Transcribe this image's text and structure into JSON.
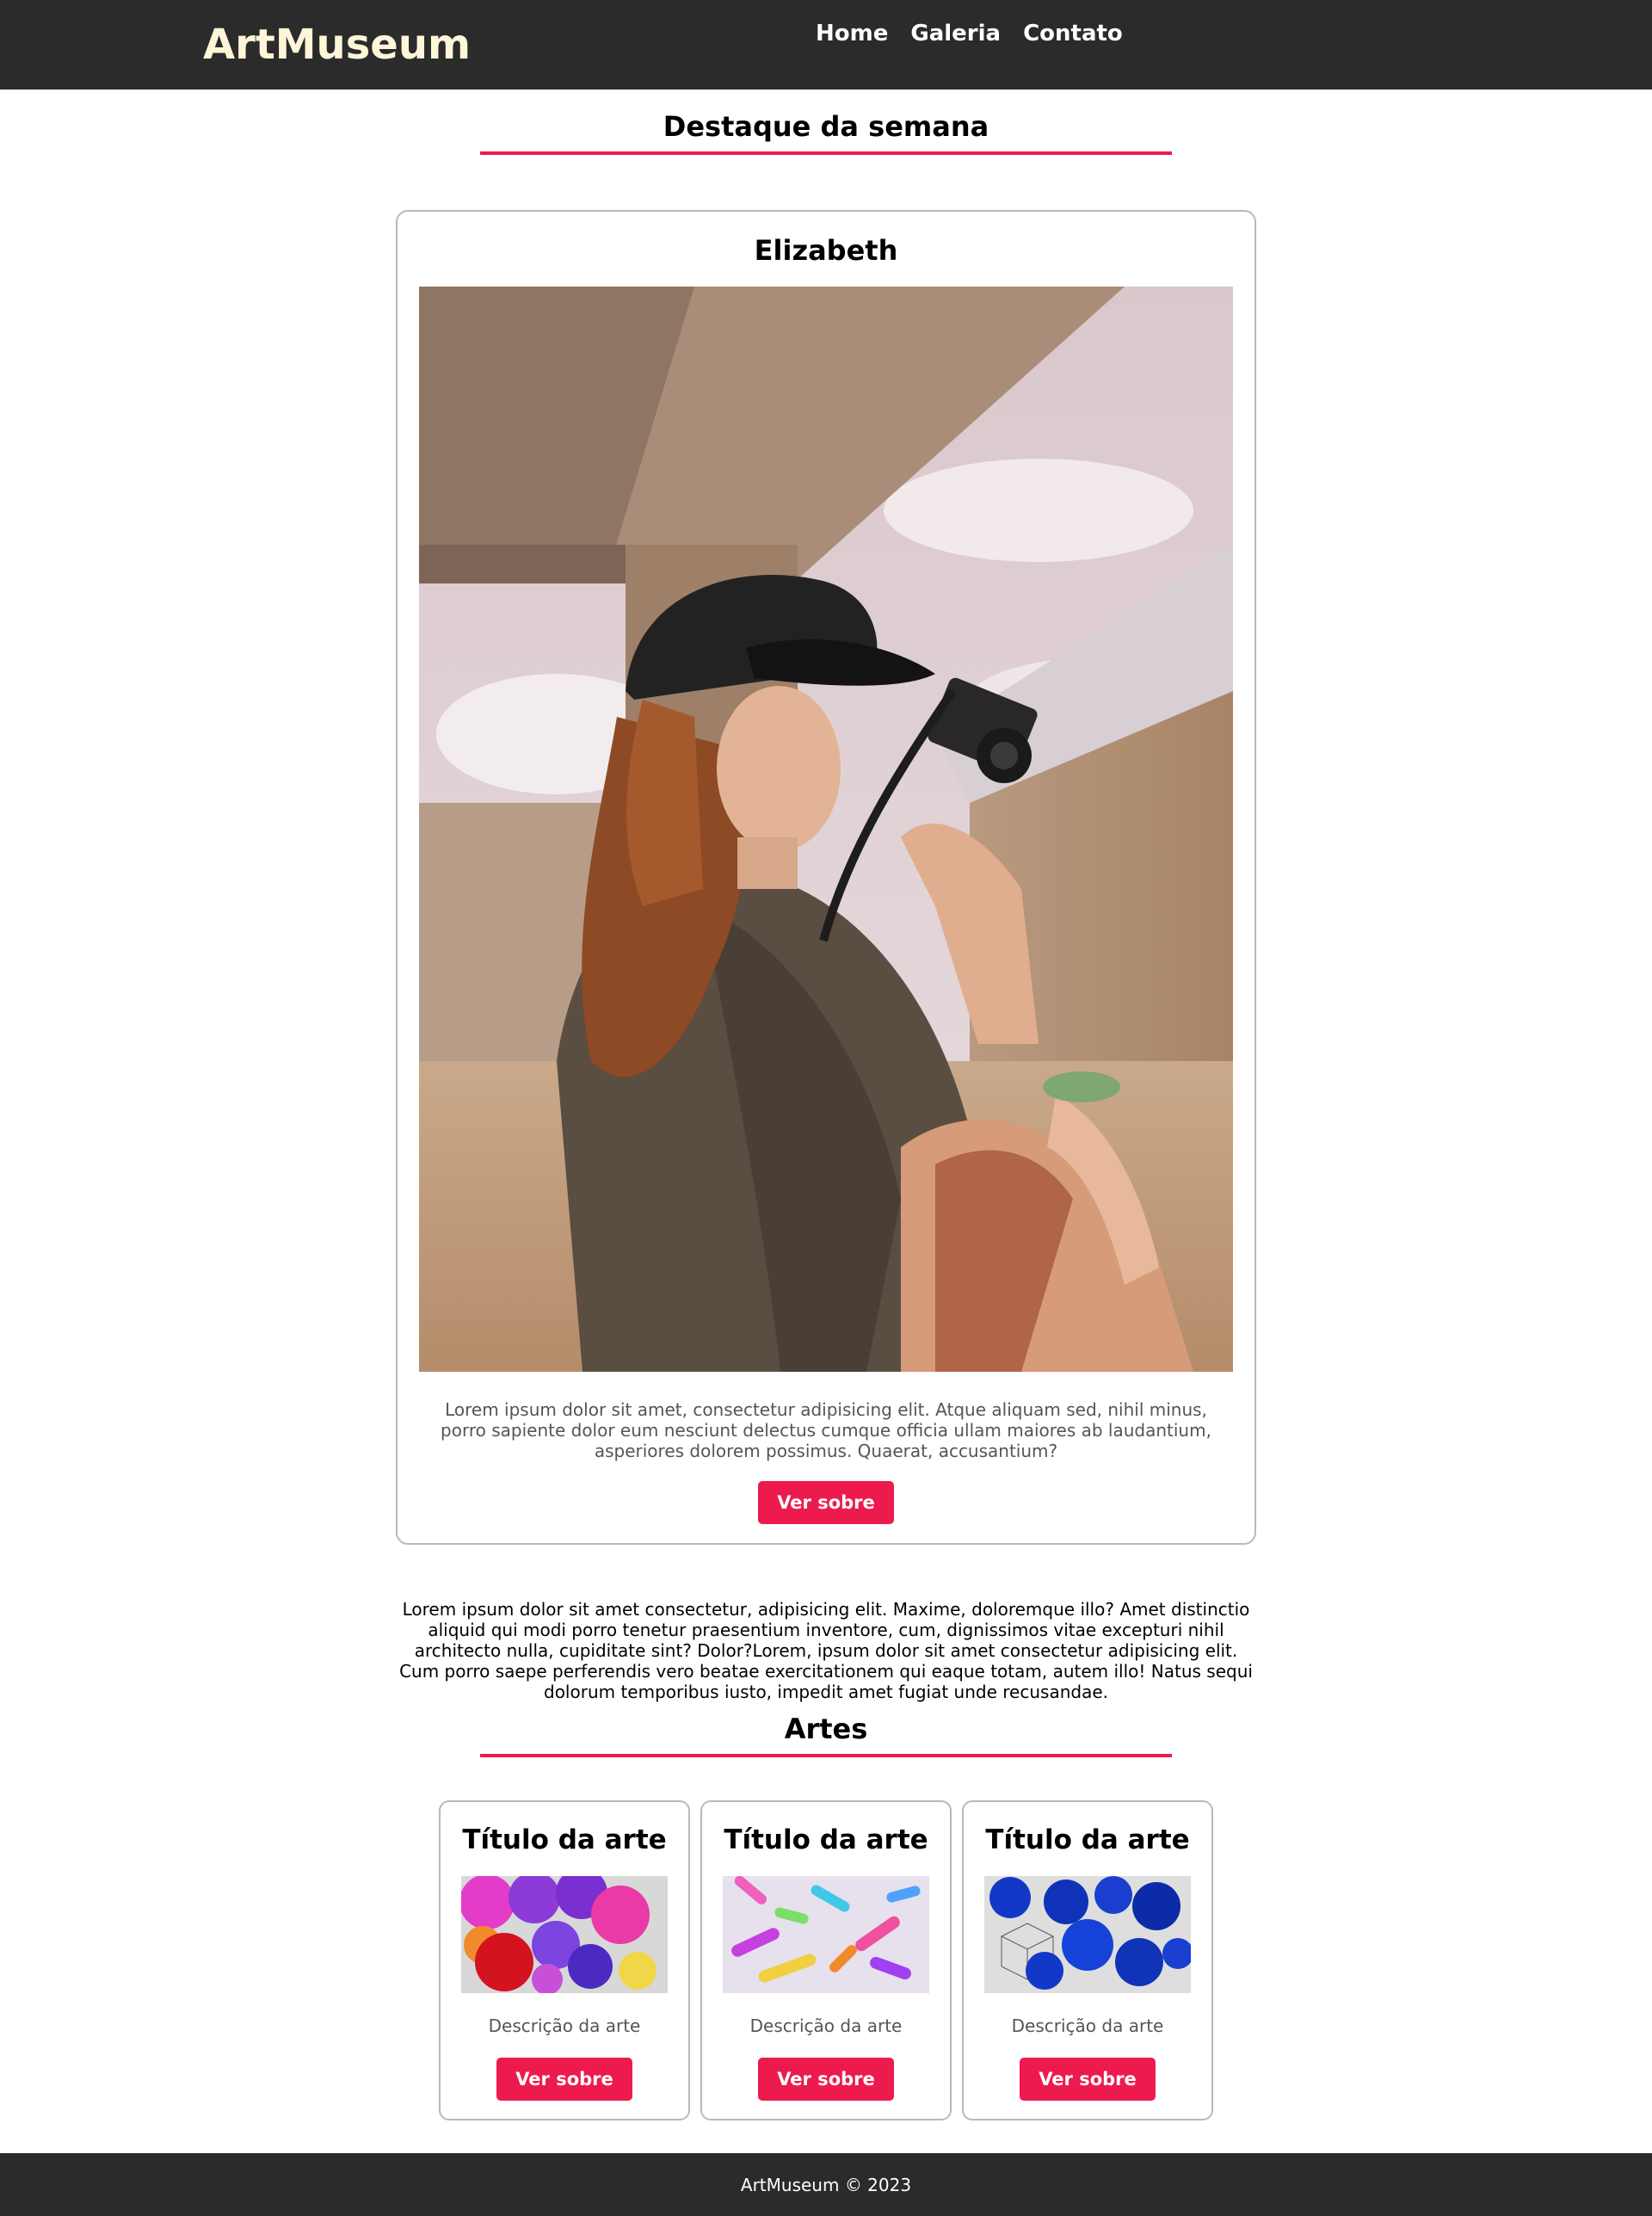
{
  "header": {
    "logo": "ArtMuseum",
    "nav": [
      "Home",
      "Galeria",
      "Contato"
    ]
  },
  "featured": {
    "section_title": "Destaque da semana",
    "name": "Elizabeth",
    "image_alt": "woman-with-camera-photo",
    "description": "Lorem ipsum dolor sit amet, consectetur adipisicing elit. Atque aliquam sed, nihil minus, porro sapiente dolor eum nesciunt delectus cumque officia ullam maiores ab laudantium, asperiores dolorem possimus. Quaerat, accusantium?",
    "button": "Ver sobre"
  },
  "intro_text": "Lorem ipsum dolor sit amet consectetur, adipisicing elit. Maxime, doloremque illo? Amet distinctio aliquid qui modi porro tenetur praesentium inventore, cum, dignissimos vitae excepturi nihil architecto nulla, cupiditate sint? Dolor?Lorem, ipsum dolor sit amet consectetur adipisicing elit. Cum porro saepe perferendis vero beatae exercitationem qui eaque totam, autem illo! Natus sequi dolorum temporibus iusto, impedit amet fugiat unde recusandae.",
  "arts": {
    "section_title": "Artes",
    "items": [
      {
        "title": "Título da arte",
        "description": "Descrição da arte",
        "button": "Ver sobre",
        "image": "colorful-3d-blobs"
      },
      {
        "title": "Título da arte",
        "description": "Descrição da arte",
        "button": "Ver sobre",
        "image": "colorful-3d-ribbons"
      },
      {
        "title": "Título da arte",
        "description": "Descrição da arte",
        "button": "Ver sobre",
        "image": "blue-3d-shapes"
      }
    ]
  },
  "footer": {
    "text": "ArtMuseum © 2023"
  },
  "colors": {
    "accent": "#ed1a4e",
    "header_bg": "#2b2b2b",
    "logo": "#fff6d9"
  }
}
